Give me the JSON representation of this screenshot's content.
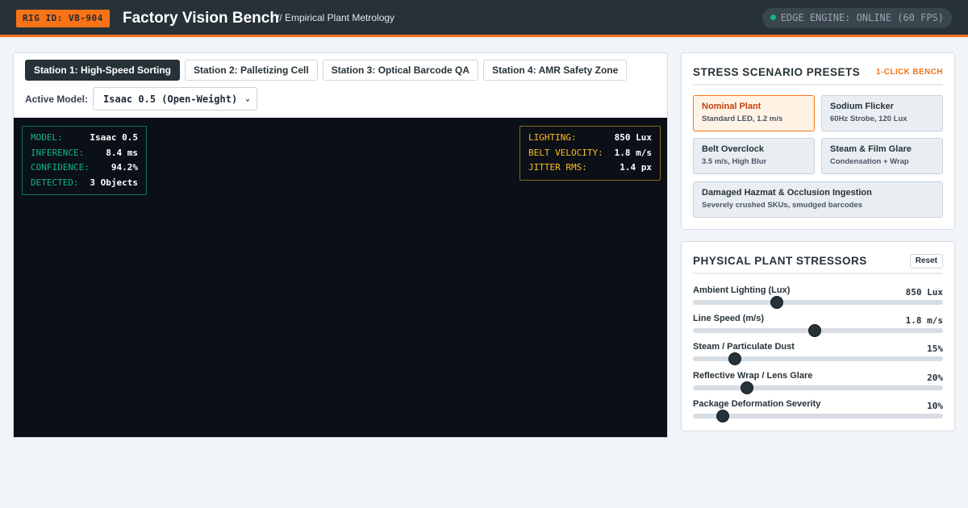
{
  "header": {
    "rig_badge": "RIG ID: VB-904",
    "title": "Factory Vision Bench",
    "subtitle": "// Empirical Plant Metrology",
    "engine_status": "EDGE ENGINE: ONLINE (60 FPS)",
    "engine_status_color": "#10b981",
    "accent_color": "#f97316"
  },
  "main": {
    "tabs": [
      {
        "label": "Station 1: High-Speed Sorting",
        "active": true
      },
      {
        "label": "Station 2: Palletizing Cell",
        "active": false
      },
      {
        "label": "Station 3: Optical Barcode QA",
        "active": false
      },
      {
        "label": "Station 4: AMR Safety Zone",
        "active": false
      }
    ],
    "model_label": "Active Model:",
    "model_selected": "Isaac 0.5 (Open-Weight)",
    "hud_left": [
      {
        "key": "MODEL:",
        "value": "Isaac 0.5"
      },
      {
        "key": "INFERENCE:",
        "value": "8.4 ms"
      },
      {
        "key": "CONFIDENCE:",
        "value": "94.2%"
      },
      {
        "key": "DETECTED:",
        "value": "3 Objects"
      }
    ],
    "hud_right": [
      {
        "key": "LIGHTING:",
        "value": "850 Lux"
      },
      {
        "key": "BELT VELOCITY:",
        "value": "1.8 m/s"
      },
      {
        "key": "JITTER RMS:",
        "value": "1.4 px"
      }
    ]
  },
  "presets": {
    "title": "STRESS SCENARIO PRESETS",
    "tag": "1-CLICK BENCH",
    "items": [
      {
        "name": "Nominal Plant",
        "desc": "Standard LED, 1.2 m/s",
        "active": true
      },
      {
        "name": "Sodium Flicker",
        "desc": "60Hz Strobe, 120 Lux",
        "active": false
      },
      {
        "name": "Belt Overclock",
        "desc": "3.5 m/s, High Blur",
        "active": false
      },
      {
        "name": "Steam & Film Glare",
        "desc": "Condensation + Wrap",
        "active": false
      },
      {
        "name": "Damaged Hazmat & Occlusion Ingestion",
        "desc": "Severely crushed SKUs, smudged barcodes",
        "active": false
      }
    ]
  },
  "stressors": {
    "title": "PHYSICAL PLANT STRESSORS",
    "reset_label": "Reset",
    "sliders": [
      {
        "label": "Ambient Lighting (Lux)",
        "value_text": "850 Lux",
        "fraction": 0.335
      },
      {
        "label": "Line Speed (m/s)",
        "value_text": "1.8 m/s",
        "fraction": 0.487
      },
      {
        "label": "Steam / Particulate Dust",
        "value_text": "15%",
        "fraction": 0.168
      },
      {
        "label": "Reflective Wrap / Lens Glare",
        "value_text": "20%",
        "fraction": 0.216
      },
      {
        "label": "Package Deformation Severity",
        "value_text": "10%",
        "fraction": 0.12
      }
    ]
  }
}
